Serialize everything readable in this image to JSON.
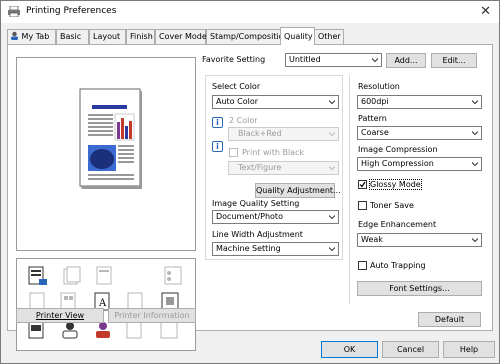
{
  "window": {
    "title": "Printing Preferences",
    "close_glyph": "✕"
  },
  "tabs": [
    "My Tab",
    "Basic",
    "Layout",
    "Finish",
    "Cover Mode",
    "Stamp/Composition",
    "Quality",
    "Other"
  ],
  "active_tab": "Quality",
  "favorite": {
    "label": "Favorite Setting",
    "value": "Untitled",
    "add_label": "Add...",
    "edit_label": "Edit..."
  },
  "left": {
    "printer_view_label": "Printer View",
    "printer_info_label": "Printer Information"
  },
  "color": {
    "select_color_label": "Select Color",
    "select_color_value": "Auto Color",
    "two_color_label": "2 Color",
    "two_color_value": "Black+Red",
    "print_with_black_label": "Print with Black",
    "print_with_black_value": "Text/Figure",
    "info_glyph": "i",
    "quality_adjustment_label": "Quality Adjustment...",
    "image_quality_label": "Image Quality Setting",
    "image_quality_value": "Document/Photo",
    "line_width_label": "Line Width Adjustment",
    "line_width_value": "Machine Setting"
  },
  "right": {
    "resolution_label": "Resolution",
    "resolution_value": "600dpi",
    "pattern_label": "Pattern",
    "pattern_value": "Coarse",
    "compression_label": "Image Compression",
    "compression_value": "High Compression",
    "glossy_label": "Glossy Mode",
    "glossy_checked": true,
    "toner_save_label": "Toner Save",
    "toner_save_checked": false,
    "edge_label": "Edge Enhancement",
    "edge_value": "Weak",
    "auto_trapping_label": "Auto Trapping",
    "auto_trapping_checked": false,
    "font_settings_label": "Font Settings...",
    "default_label": "Default"
  },
  "footer": {
    "ok": "OK",
    "cancel": "Cancel",
    "help": "Help"
  },
  "colors": {
    "accent": "#0078d7",
    "chart_red": "#c0392b",
    "chart_blue": "#2b3aa0",
    "chart_purple": "#7a3a8f"
  },
  "icons": [
    "printer-icon",
    "checkmark-icon",
    "chevron-down-icon",
    "info-icon",
    "close-icon"
  ]
}
